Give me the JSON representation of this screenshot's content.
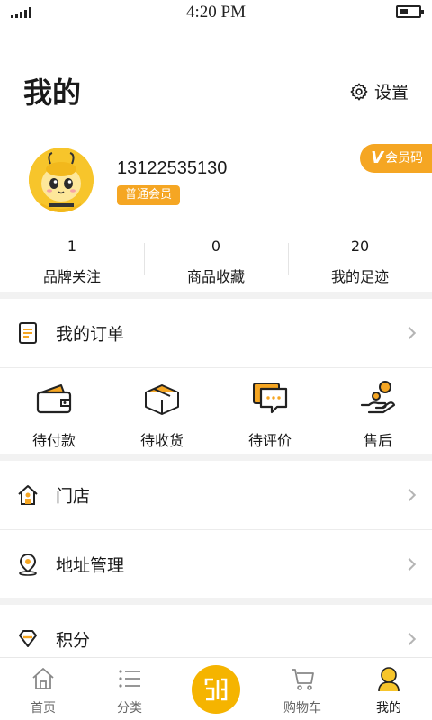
{
  "status_bar": {
    "time": "4:20 PM",
    "battery_level": 0.45
  },
  "header": {
    "title": "我的",
    "settings_label": "设置"
  },
  "profile": {
    "phone": "13122535130",
    "member_level": "普通会员",
    "member_code_label": "会员码",
    "member_code_mark": "V"
  },
  "stats": [
    {
      "value": "1",
      "label": "品牌关注"
    },
    {
      "value": "0",
      "label": "商品收藏"
    },
    {
      "value": "20",
      "label": "我的足迹"
    }
  ],
  "orders": {
    "title": "我的订单",
    "items": [
      {
        "label": "待付款",
        "icon": "wallet-icon"
      },
      {
        "label": "待收货",
        "icon": "package-icon"
      },
      {
        "label": "待评价",
        "icon": "comment-icon"
      },
      {
        "label": "售后",
        "icon": "after-sales-icon"
      }
    ]
  },
  "menu": {
    "store": "门店",
    "address": "地址管理",
    "points": "积分"
  },
  "tabbar": {
    "items": [
      {
        "label": "首页",
        "icon": "home-icon"
      },
      {
        "label": "分类",
        "icon": "category-list-icon"
      },
      {
        "label": "",
        "icon": "scan-code-icon"
      },
      {
        "label": "购物车",
        "icon": "cart-icon"
      },
      {
        "label": "我的",
        "icon": "profile-bee-icon"
      }
    ],
    "active_index": 4
  },
  "colors": {
    "accent": "#f5a623",
    "scan_button": "#f5b400",
    "separator": "#f2f2f2",
    "icon_dark": "#222222"
  }
}
